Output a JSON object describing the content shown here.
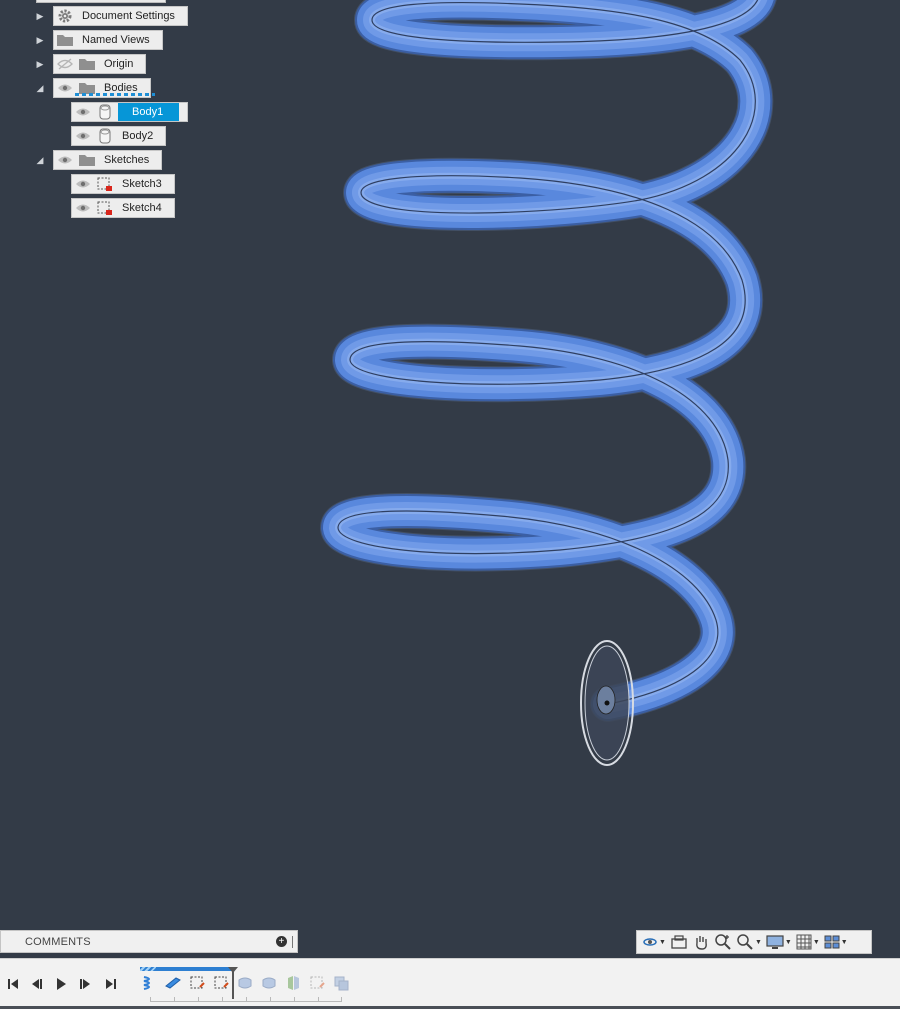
{
  "browser": {
    "items": [
      {
        "label": "Document Settings",
        "icon": "gear-icon",
        "expander": "collapsed"
      },
      {
        "label": "Named Views",
        "icon": "folder-icon",
        "expander": "collapsed"
      },
      {
        "label": "Origin",
        "icon": "folder-icon",
        "expander": "collapsed",
        "visibility": "hidden-eye-icon"
      },
      {
        "label": "Bodies",
        "icon": "folder-icon",
        "expander": "expanded",
        "visibility": "eye-icon"
      },
      {
        "label": "Body1",
        "icon": "body-icon",
        "visibility": "eye-icon",
        "selected": true
      },
      {
        "label": "Body2",
        "icon": "body-icon",
        "visibility": "eye-icon"
      },
      {
        "label": "Sketches",
        "icon": "folder-icon",
        "expander": "expanded",
        "visibility": "eye-icon"
      },
      {
        "label": "Sketch3",
        "icon": "sketch-icon",
        "visibility": "eye-icon"
      },
      {
        "label": "Sketch4",
        "icon": "sketch-icon",
        "visibility": "eye-icon"
      }
    ]
  },
  "comments": {
    "label": "COMMENTS"
  },
  "navbar": {
    "tools": [
      "orbit-icon",
      "look-at-icon",
      "pan-icon",
      "zoom-icon",
      "zoom-window-icon",
      "display-settings-icon",
      "grid-settings-icon",
      "viewports-icon"
    ]
  },
  "timeline": {
    "playback": [
      "skip-to-start-icon",
      "step-back-icon",
      "play-icon",
      "step-forward-icon",
      "skip-to-end-icon"
    ],
    "features": [
      "coil-feature-icon",
      "plane-feature-icon",
      "sketch-feature-icon",
      "sketch-feature-icon",
      "sweep-feature-icon",
      "sweep-feature-icon",
      "split-feature-icon",
      "sketch-feature-icon",
      "combine-feature-icon"
    ],
    "active_feature_count": 4
  },
  "colors": {
    "viewport_bg": "#333b47",
    "body_blue": "#4f7fd8",
    "selection": "#0696d7"
  }
}
